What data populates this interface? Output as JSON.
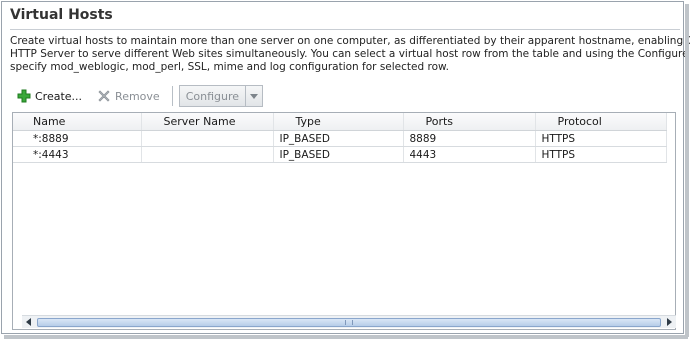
{
  "panel": {
    "title": "Virtual Hosts",
    "description_lines": [
      "Create virtual hosts to maintain more than one server on one computer, as differentiated by their apparent hostname, enabling Oracle",
      "HTTP Server to serve different Web sites simultaneously. You can select a virtual host row from the table and using the Configure menu",
      "specify mod_weblogic, mod_perl, SSL, mime and log configuration for selected row."
    ]
  },
  "toolbar": {
    "create_label": "Create...",
    "remove_label": "Remove",
    "configure_label": "Configure",
    "create_icon": "green-plus-icon",
    "remove_icon": "gray-x-icon",
    "configure_dropdown_icon": "chevron-down-icon"
  },
  "table": {
    "columns": [
      "Name",
      "Server Name",
      "Type",
      "Ports",
      "Protocol"
    ],
    "rows": [
      {
        "name": "*:8889",
        "server_name": "",
        "type": "IP_BASED",
        "ports": "8889",
        "protocol": "HTTPS"
      },
      {
        "name": "*:4443",
        "server_name": "",
        "type": "IP_BASED",
        "ports": "4443",
        "protocol": "HTTPS"
      }
    ]
  },
  "scrollbar": {
    "left_icon": "arrow-left-icon",
    "right_icon": "arrow-right-icon",
    "thumb_fraction": 0.97
  },
  "colors": {
    "accent_plus": "#2e9b2e",
    "disabled_text": "#8a8f95",
    "scroll_thumb": "#b7cde8"
  }
}
